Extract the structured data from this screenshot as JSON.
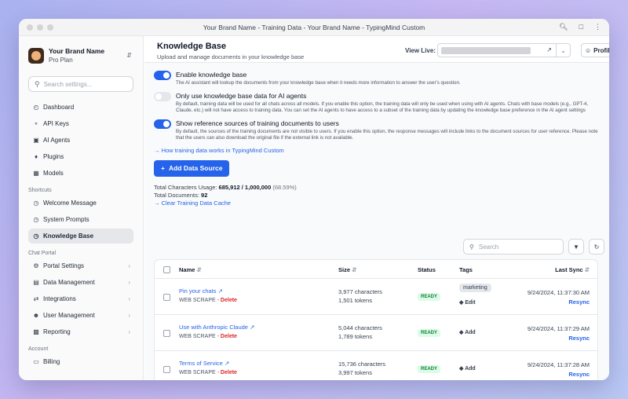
{
  "window": {
    "title": "Your Brand Name - Training Data - Your Brand Name - TypingMind Custom"
  },
  "sidebar": {
    "brand_name": "Your Brand Name",
    "brand_plan": "Pro Plan",
    "search_placeholder": "Search settings...",
    "items": [
      {
        "label": "Dashboard"
      },
      {
        "label": "API Keys"
      },
      {
        "label": "AI Agents"
      },
      {
        "label": "Plugins"
      },
      {
        "label": "Models"
      }
    ],
    "shortcuts_label": "Shortcuts",
    "shortcuts": [
      {
        "label": "Welcome Message"
      },
      {
        "label": "System Prompts"
      },
      {
        "label": "Knowledge Base"
      }
    ],
    "chat_portal_label": "Chat Portal",
    "chat_portal": [
      {
        "label": "Portal Settings"
      },
      {
        "label": "Data Management"
      },
      {
        "label": "Integrations"
      },
      {
        "label": "User Management"
      },
      {
        "label": "Reporting"
      }
    ],
    "account_label": "Account",
    "account": [
      {
        "label": "Billing"
      }
    ]
  },
  "header": {
    "title": "Knowledge Base",
    "subtitle": "Upload and manage documents in your knowledge base",
    "view_live_label": "View Live:",
    "profile_label": "Profile"
  },
  "settings": {
    "enable_kb": {
      "title": "Enable knowledge base",
      "desc": "The AI assistant will lookup the documents from your knowledge base when it needs more information to answer the user's question.",
      "on": true
    },
    "only_agents": {
      "title": "Only use knowledge base data for AI agents",
      "desc": "By default, training data will be used for all chats across all models. If you enable this option, the training data will only be used when using with AI agents. Chats with base models (e.g., GPT-4, Claude, etc.) will not have access to training data. You can set the AI agents to have access to a subset of the training data by updating the knowledge base preference in the AI agent settings",
      "on": false
    },
    "show_sources": {
      "title": "Show reference sources of training documents to users",
      "desc": "By default, the sources of the training documents are not visible to users. If you enable this option, the response messages will include links to the document sources for user reference. Please note that the users can also download the original file if the external link is not available.",
      "on": true
    },
    "help_link": "→ How training data works in TypingMind Custom"
  },
  "actions": {
    "add_source": "Add Data Source"
  },
  "usage": {
    "chars_label": "Total Characters Usage:",
    "chars_value": "685,912 / 1,000,000",
    "chars_pct": "(68.59%)",
    "docs_label": "Total Documents:",
    "docs_value": "92",
    "clear_cache": "→ Clear Training Data Cache"
  },
  "table": {
    "search_placeholder": "Search",
    "headers": {
      "name": "Name",
      "size": "Size",
      "status": "Status",
      "tags": "Tags",
      "last_sync": "Last Sync"
    },
    "rows": [
      {
        "name": "Pin your chats",
        "source": "WEB SCRAPE",
        "delete": "Delete",
        "chars": "3,977 characters",
        "tokens": "1,501 tokens",
        "status": "READY",
        "tag": "marketing",
        "tag_action": "Edit",
        "sync": "9/24/2024, 11:37:30 AM",
        "resync": "Resync"
      },
      {
        "name": "Use with Anthropic Claude",
        "source": "WEB SCRAPE",
        "delete": "Delete",
        "chars": "5,044 characters",
        "tokens": "1,789 tokens",
        "status": "READY",
        "tag": "",
        "tag_action": "Add",
        "sync": "9/24/2024, 11:37:29 AM",
        "resync": "Resync"
      },
      {
        "name": "Terms of Service",
        "source": "WEB SCRAPE",
        "delete": "Delete",
        "chars": "15,736 characters",
        "tokens": "3,997 tokens",
        "status": "READY",
        "tag": "",
        "tag_action": "Add",
        "sync": "9/24/2024, 11:37:28 AM",
        "resync": "Resync"
      }
    ]
  },
  "colors": {
    "accent": "#2563eb",
    "danger": "#dc2626",
    "ready": "#15803d"
  }
}
